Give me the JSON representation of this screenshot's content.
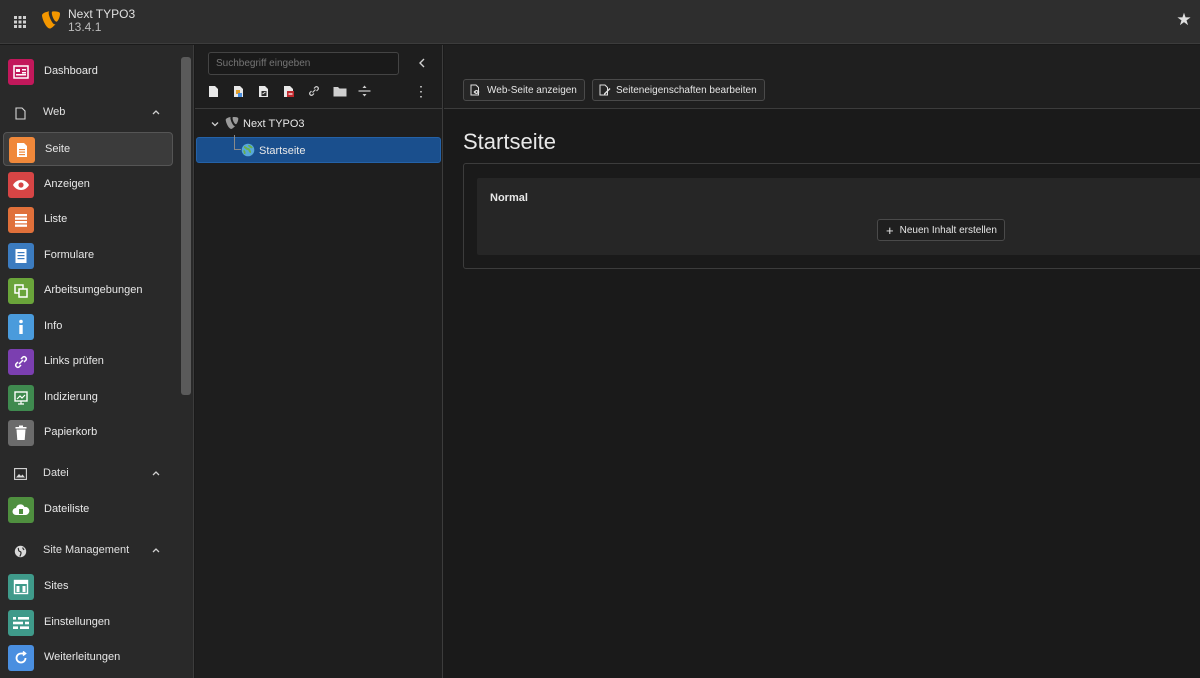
{
  "topbar": {
    "site_name": "Next TYPO3",
    "version": "13.4.1"
  },
  "module_menu": {
    "groups": [
      {
        "label": "Web",
        "icon": "page-icon",
        "items": [
          {
            "label": "Seite",
            "icon": "page-module-icon",
            "color": "#f0883a",
            "active": true
          },
          {
            "label": "Anzeigen",
            "icon": "eye-icon",
            "color": "#d64545"
          },
          {
            "label": "Liste",
            "icon": "list-icon",
            "color": "#e0703a"
          },
          {
            "label": "Formulare",
            "icon": "form-icon",
            "color": "#3c7cc0"
          },
          {
            "label": "Arbeitsumgebungen",
            "icon": "workspace-icon",
            "color": "#6aa43a"
          },
          {
            "label": "Info",
            "icon": "info-icon",
            "color": "#4a9bdc"
          },
          {
            "label": "Links prüfen",
            "icon": "link-icon",
            "color": "#7b3fb0"
          },
          {
            "label": "Indizierung",
            "icon": "presentation-icon",
            "color": "#3f8a4f"
          },
          {
            "label": "Papierkorb",
            "icon": "trash-icon",
            "color": "#6b6b6b"
          }
        ]
      },
      {
        "label": "Datei",
        "icon": "image-icon",
        "items": [
          {
            "label": "Dateiliste",
            "icon": "cloud-file-icon",
            "color": "#4f8f3f"
          }
        ]
      },
      {
        "label": "Site Management",
        "icon": "globe-icon",
        "items": [
          {
            "label": "Sites",
            "icon": "sites-icon",
            "color": "#3f9a8a"
          },
          {
            "label": "Einstellungen",
            "icon": "settings-sliders-icon",
            "color": "#3f9a8a"
          },
          {
            "label": "Weiterleitungen",
            "icon": "redirect-icon",
            "color": "#4a8fe0"
          }
        ]
      }
    ]
  },
  "tree": {
    "search_placeholder": "Suchbegriff eingeben",
    "root_label": "Next TYPO3",
    "page_label": "Startseite"
  },
  "docheader": {
    "view_label": "Web-Seite anzeigen",
    "edit_label": "Seiteneigenschaften bearbeiten"
  },
  "content": {
    "title": "Startseite",
    "column_name": "Normal",
    "new_content_label": "Neuen Inhalt erstellen"
  }
}
